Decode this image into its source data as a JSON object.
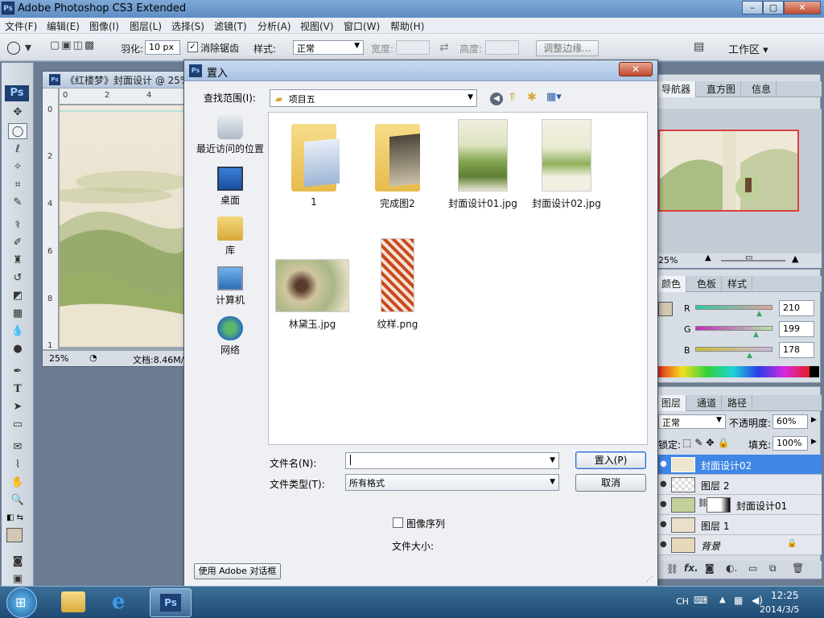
{
  "app": {
    "title": "Adobe Photoshop CS3 Extended",
    "logo": "Ps",
    "window_buttons": [
      "–",
      "▢",
      "✕"
    ]
  },
  "menu": [
    "文件(F)",
    "编辑(E)",
    "图像(I)",
    "图层(L)",
    "选择(S)",
    "滤镜(T)",
    "分析(A)",
    "视图(V)",
    "窗口(W)",
    "帮助(H)"
  ],
  "options": {
    "feather_label": "羽化:",
    "feather_value": "10 px",
    "antialias_label": "消除锯齿",
    "antialias_checked": true,
    "style_label": "样式:",
    "style_value": "正常",
    "width_label": "宽度:",
    "height_label": "高度:",
    "refine_edge": "调整边缘...",
    "workspace_label": "工作区 ▾"
  },
  "document": {
    "title": "《红楼梦》封面设计 @ 25%",
    "zoom": "25%",
    "file_size": "文档:8.46M/",
    "ruler_top": [
      "0",
      "2",
      "4"
    ],
    "ruler_left": [
      "0",
      "2",
      "4",
      "6",
      "8",
      "1"
    ]
  },
  "navigator": {
    "tabs": [
      "导航器",
      "直方图",
      "信息"
    ],
    "zoom": "25%"
  },
  "color_panel": {
    "tabs": [
      "颜色",
      "色板",
      "样式"
    ],
    "channels": [
      {
        "label": "R",
        "value": "210"
      },
      {
        "label": "G",
        "value": "199"
      },
      {
        "label": "B",
        "value": "178"
      }
    ],
    "swatch_color": "#d2c7b2"
  },
  "layers_panel": {
    "tabs": [
      "图层",
      "通道",
      "路径"
    ],
    "blend_mode": "正常",
    "opacity_label": "不透明度:",
    "opacity_value": "60%",
    "lock_label": "锁定:",
    "fill_label": "填充:",
    "fill_value": "100%",
    "layers": [
      {
        "name": "封面设计02",
        "selected": true
      },
      {
        "name": "图层 2",
        "selected": false
      },
      {
        "name": "封面设计01",
        "selected": false
      },
      {
        "name": "图层 1",
        "selected": false
      },
      {
        "name": "背景",
        "selected": false
      }
    ],
    "footer_icons": [
      "link-icon",
      "fx-icon",
      "mask-icon",
      "adjustment-icon",
      "folder-icon",
      "new-layer-icon",
      "trash-icon"
    ]
  },
  "dialog": {
    "title": "置入",
    "look_in_label": "查找范围(I):",
    "look_in_value": "项目五",
    "places": [
      "最近访问的位置",
      "桌面",
      "库",
      "计算机",
      "网络"
    ],
    "files": [
      "1",
      "完成图2",
      "封面设计01.jpg",
      "封面设计02.jpg",
      "林黛玉.jpg",
      "纹样.png"
    ],
    "filename_label": "文件名(N):",
    "filename_value": "",
    "filetype_label": "文件类型(T):",
    "filetype_value": "所有格式",
    "place_button": "置入(P)",
    "cancel_button": "取消",
    "image_sequence_label": "图像序列",
    "image_sequence_checked": false,
    "file_size_label": "文件大小:",
    "adobe_dialog_button": "使用 Adobe 对话框"
  },
  "taskbar": {
    "items": [
      "windows-start",
      "explorer",
      "internet-explorer",
      "photoshop"
    ],
    "lang": "CH",
    "time": "12:25",
    "date": "2014/3/5"
  },
  "colors": {
    "selection_blue": "#3f86e6",
    "accent_red": "#d84040"
  }
}
